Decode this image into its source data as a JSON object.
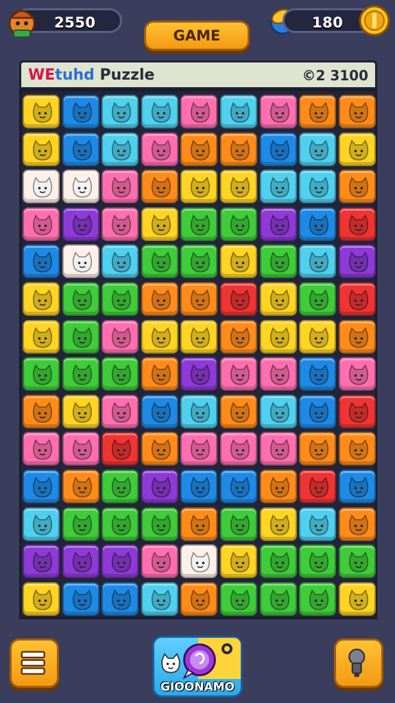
{
  "hud": {
    "score": "2550",
    "coins": "180",
    "play_button_label": "GAME"
  },
  "title": {
    "part1": "WE",
    "part2": "tuhd",
    "part3": " Puzzle",
    "level": "©2 3100"
  },
  "bottom": {
    "center_label": "GIOONAMO",
    "menu_icon": "menu-icon",
    "hint_icon": "hint-bulb-icon"
  },
  "colors": {
    "Y": "#ffd423",
    "B": "#1f8ae6",
    "C": "#4fd0ee",
    "P": "#ff6fb0",
    "O": "#ff8c1a",
    "R": "#ef3434",
    "G": "#3fcb3a",
    "V": "#8e3ad6",
    "W": "#fff1ea"
  },
  "board": {
    "rows": [
      [
        "Y",
        "B",
        "C",
        "C",
        "P",
        "C",
        "P",
        "O",
        "O"
      ],
      [
        "Y",
        "B",
        "C",
        "P",
        "O",
        "O",
        "B",
        "C",
        "Y"
      ],
      [
        "W",
        "W",
        "P",
        "O",
        "Y",
        "Y",
        "C",
        "C",
        "O"
      ],
      [
        "P",
        "V",
        "P",
        "Y",
        "G",
        "G",
        "V",
        "B",
        "R"
      ],
      [
        "B",
        "W",
        "C",
        "G",
        "G",
        "Y",
        "G",
        "C",
        "V"
      ],
      [
        "Y",
        "G",
        "G",
        "O",
        "O",
        "R",
        "Y",
        "G",
        "R"
      ],
      [
        "Y",
        "G",
        "P",
        "Y",
        "Y",
        "O",
        "Y",
        "Y",
        "O"
      ],
      [
        "G",
        "G",
        "G",
        "O",
        "V",
        "P",
        "P",
        "B",
        "P"
      ],
      [
        "O",
        "Y",
        "P",
        "B",
        "C",
        "O",
        "C",
        "B",
        "R"
      ],
      [
        "P",
        "P",
        "R",
        "O",
        "P",
        "P",
        "P",
        "O",
        "O"
      ],
      [
        "B",
        "O",
        "G",
        "V",
        "B",
        "B",
        "O",
        "R",
        "B"
      ],
      [
        "C",
        "G",
        "G",
        "G",
        "O",
        "G",
        "Y",
        "C",
        "O"
      ],
      [
        "V",
        "V",
        "V",
        "P",
        "W",
        "Y",
        "G",
        "G",
        "G"
      ],
      [
        "Y",
        "B",
        "B",
        "C",
        "O",
        "G",
        "G",
        "G",
        "Y"
      ]
    ]
  }
}
